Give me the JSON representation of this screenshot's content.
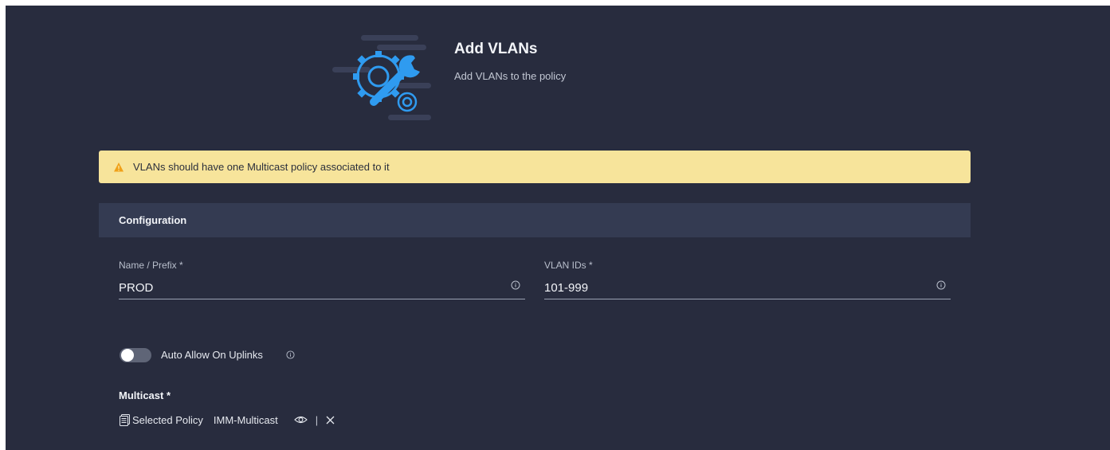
{
  "header": {
    "title": "Add VLANs",
    "subtitle": "Add VLANs to the policy",
    "icon": "gear-wrench-icon"
  },
  "warning": {
    "text": "VLANs should have one Multicast policy associated to it",
    "icon": "warning-triangle-icon",
    "color": "#f7e49b"
  },
  "configuration": {
    "section_title": "Configuration",
    "name_prefix": {
      "label": "Name / Prefix *",
      "value": "PROD"
    },
    "vlan_ids": {
      "label": "VLAN IDs *",
      "value": "101-999"
    },
    "auto_allow": {
      "label": "Auto Allow On Uplinks",
      "enabled": false
    }
  },
  "multicast": {
    "label": "Multicast *",
    "selected_label": "Selected Policy",
    "policy_name": "IMM-Multicast",
    "separator": "|"
  },
  "colors": {
    "background": "#282c3e",
    "section_header": "#343b52",
    "accent_blue": "#2f9bf0"
  }
}
